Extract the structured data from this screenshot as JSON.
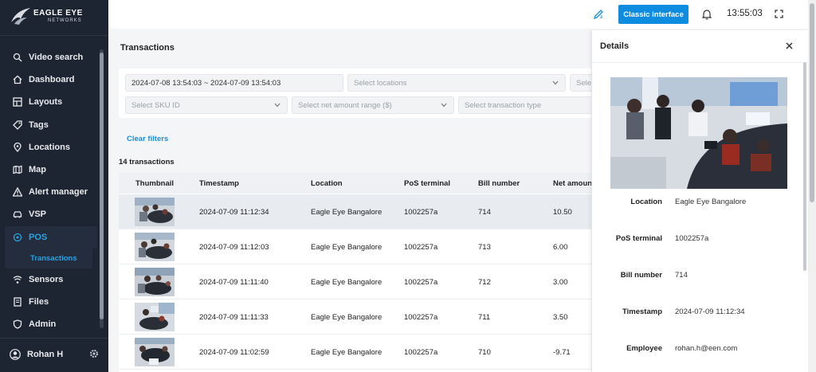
{
  "app": {
    "brand": "EAGLE EYE",
    "brand_sub": "NETWORKS"
  },
  "sidebar": {
    "items": [
      {
        "label": "Video search",
        "icon": "video-search-icon"
      },
      {
        "label": "Dashboard",
        "icon": "home-icon"
      },
      {
        "label": "Layouts",
        "icon": "layouts-icon"
      },
      {
        "label": "Tags",
        "icon": "tag-icon"
      },
      {
        "label": "Locations",
        "icon": "location-pin-icon"
      },
      {
        "label": "Map",
        "icon": "map-icon"
      },
      {
        "label": "Alert manager",
        "icon": "alert-icon"
      },
      {
        "label": "VSP",
        "icon": "car-icon"
      },
      {
        "label": "POS",
        "icon": "pos-icon",
        "active": true
      },
      {
        "label": "Sensors",
        "icon": "sensor-icon"
      },
      {
        "label": "Files",
        "icon": "files-icon"
      },
      {
        "label": "Admin",
        "icon": "shield-icon"
      }
    ],
    "sub_item": "Transactions",
    "user_name": "Rohan H"
  },
  "topbar": {
    "classic_label": "Classic interface",
    "time": "13:55:03"
  },
  "main": {
    "title": "Transactions",
    "filters": {
      "date_range": "2024-07-08 13:54:03 ~ 2024-07-09 13:54:03",
      "locations": "Select locations",
      "cut": "Sele",
      "sku": "Select SKU ID",
      "net_amount": "Select net amount range ($)",
      "transaction_type": "Select transaction type"
    },
    "clear_filters": "Clear filters",
    "count": "14 transactions",
    "columns": [
      "Thumbnail",
      "Timestamp",
      "Location",
      "PoS terminal",
      "Bill number",
      "Net amount"
    ],
    "rows": [
      {
        "timestamp": "2024-07-09 11:12:34",
        "location": "Eagle Eye Bangalore",
        "terminal": "1002257a",
        "bill": "714",
        "amount": "10.50"
      },
      {
        "timestamp": "2024-07-09 11:12:03",
        "location": "Eagle Eye Bangalore",
        "terminal": "1002257a",
        "bill": "713",
        "amount": "6.00"
      },
      {
        "timestamp": "2024-07-09 11:11:40",
        "location": "Eagle Eye Bangalore",
        "terminal": "1002257a",
        "bill": "712",
        "amount": "3.00"
      },
      {
        "timestamp": "2024-07-09 11:11:33",
        "location": "Eagle Eye Bangalore",
        "terminal": "1002257a",
        "bill": "711",
        "amount": "3.50"
      },
      {
        "timestamp": "2024-07-09 11:02:59",
        "location": "Eagle Eye Bangalore",
        "terminal": "1002257a",
        "bill": "710",
        "amount": "-9.71"
      }
    ]
  },
  "details": {
    "title": "Details",
    "fields": [
      {
        "key": "Location",
        "value": "Eagle Eye Bangalore"
      },
      {
        "key": "PoS terminal",
        "value": "1002257a"
      },
      {
        "key": "Bill number",
        "value": "714"
      },
      {
        "key": "Timestamp",
        "value": "2024-07-09 11:12:34"
      },
      {
        "key": "Employee",
        "value": "rohan.h@een.com"
      }
    ]
  },
  "colors": {
    "sidebar_bg": "#1e2532",
    "accent": "#0e8de0",
    "active_text": "#2aa3e3"
  }
}
